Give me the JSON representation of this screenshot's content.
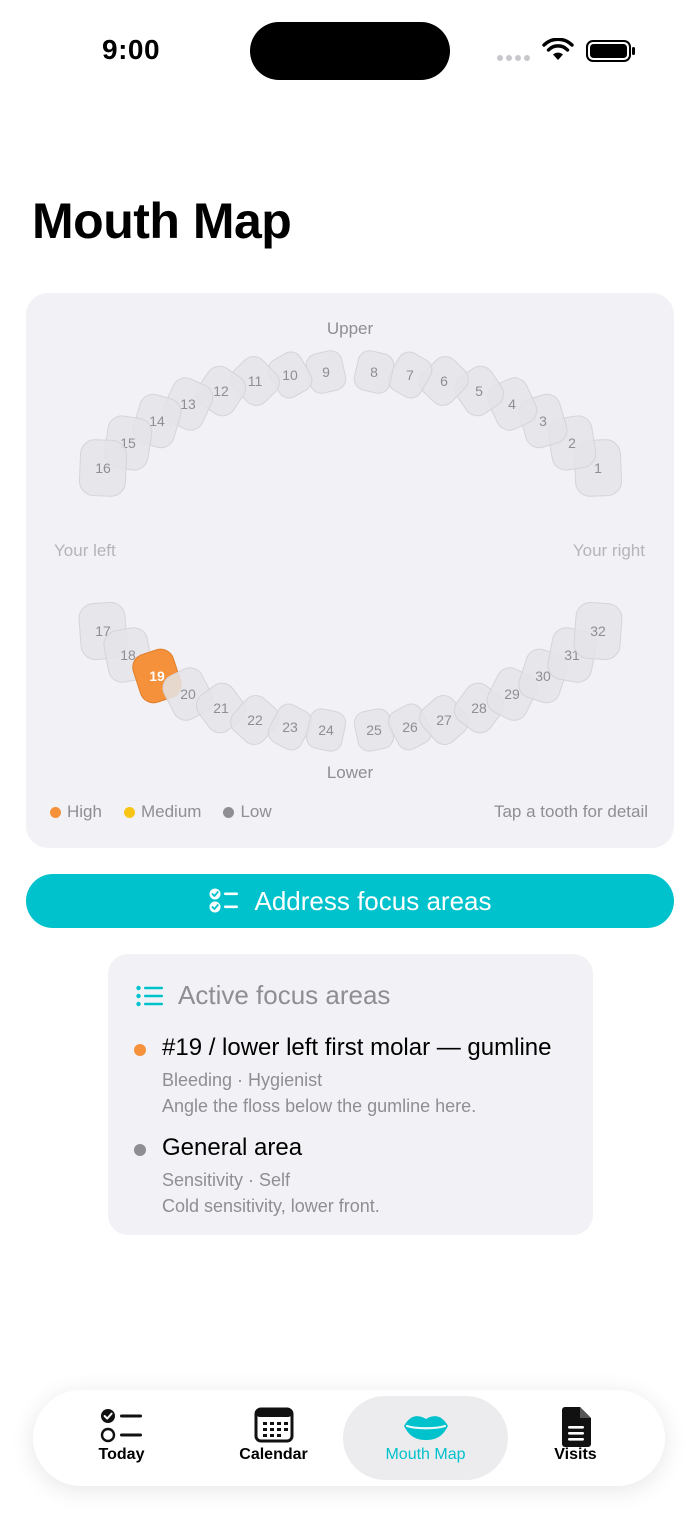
{
  "status_bar": {
    "time": "9:00"
  },
  "page_title": "Mouth Map",
  "mouth_map": {
    "upper_label": "Upper",
    "lower_label": "Lower",
    "left_label": "Your left",
    "right_label": "Your right",
    "highlighted_tooth": {
      "number": "19",
      "level": "High",
      "color": "#f5913a"
    },
    "upper_teeth": [
      "1",
      "2",
      "3",
      "4",
      "5",
      "6",
      "7",
      "8",
      "9",
      "10",
      "11",
      "12",
      "13",
      "14",
      "15",
      "16"
    ],
    "lower_teeth": [
      "17",
      "18",
      "19",
      "20",
      "21",
      "22",
      "23",
      "24",
      "25",
      "26",
      "27",
      "28",
      "29",
      "30",
      "31",
      "32"
    ],
    "legend": [
      {
        "label": "High",
        "color": "#f5913a"
      },
      {
        "label": "Medium",
        "color": "#f8c515"
      },
      {
        "label": "Low",
        "color": "#8e8e93"
      }
    ],
    "tap_hint": "Tap a tooth for detail"
  },
  "cta": {
    "label": "Address focus areas"
  },
  "focus_areas": {
    "title": "Active focus areas",
    "items": [
      {
        "name": "#19 / lower left first molar — gumline",
        "meta": "Bleeding · Hygienist",
        "note": "Angle the floss below the gumline here.",
        "color": "#f5913a"
      },
      {
        "name": "General area",
        "meta": "Sensitivity · Self",
        "note": "Cold sensitivity, lower front.",
        "color": "#8e8e93"
      }
    ]
  },
  "tab_bar": {
    "tabs": [
      {
        "label": "Today",
        "icon": "checklist-icon"
      },
      {
        "label": "Calendar",
        "icon": "calendar-icon"
      },
      {
        "label": "Mouth Map",
        "icon": "lips-icon",
        "active": true
      },
      {
        "label": "Visits",
        "icon": "document-icon"
      }
    ],
    "accent": "#00c2cc"
  }
}
